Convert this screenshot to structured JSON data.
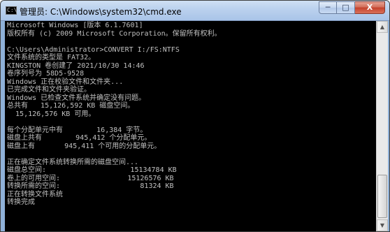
{
  "window": {
    "title": "管理员: C:\\Windows\\system32\\cmd.exe",
    "app_icon_text": "C:\\",
    "icon": "cmd-icon",
    "controls": {
      "minimize": "─",
      "maximize": "□",
      "close": "X"
    }
  },
  "scrollbar": {
    "up": "▲",
    "down": "▼"
  },
  "console": {
    "lines": [
      "Microsoft Windows [版本 6.1.7601]",
      "版权所有 (c) 2009 Microsoft Corporation。保留所有权利。",
      "",
      "C:\\Users\\Administrator>CONVERT I:/FS:NTFS",
      "文件系统的类型是 FAT32。",
      "KINGSTON 卷创建了 2021/10/30 14:46",
      "卷序列号为 58D5-9528",
      "Windows 正在校验文件和文件夹...",
      "已完成文件和文件夹验证。",
      "Windows 已检查文件系统并确定没有问题。",
      "总共有   15,126,592 KB 磁盘空间。",
      "  15,126,576 KB 可用。",
      "",
      "每个分配单元中有        16,384 字节。",
      "磁盘上共有        945,412 个分配单元。",
      "磁盘上有       945,411 个可用的分配单元。",
      "",
      "正在确定文件系统转换所需的磁盘空间...",
      "磁盘总空间:                    15134784 KB",
      "卷上的可用空间:                15126576 KB",
      "转换所需的空间:                   81324 KB",
      "正在转换文件系统",
      "转换完成"
    ]
  }
}
